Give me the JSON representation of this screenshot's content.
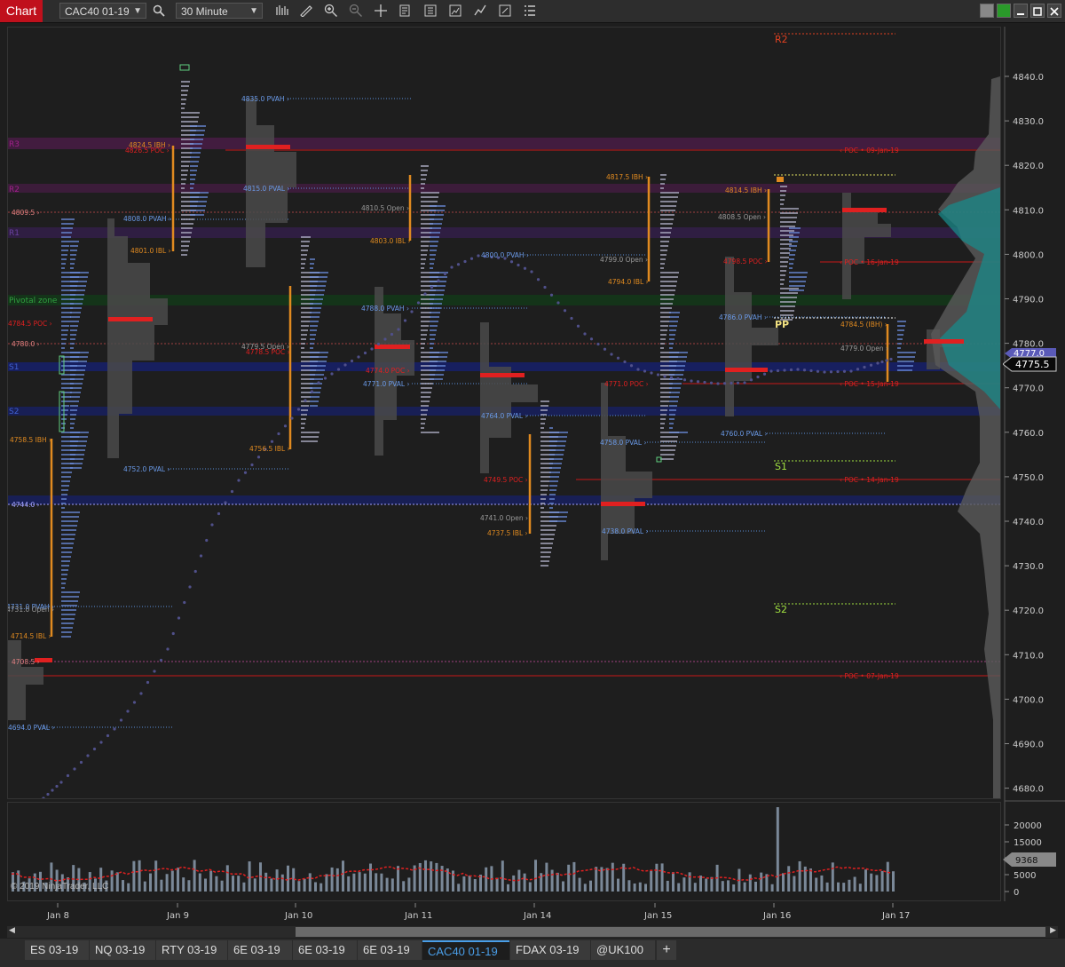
{
  "toolbar": {
    "chart_label": "Chart",
    "instrument": "CAC40 01-19",
    "interval": "30 Minute",
    "icons": [
      "search-icon",
      "bar-type-icon",
      "draw-icon",
      "zoom-in-icon",
      "zoom-out-icon",
      "crosshair-icon",
      "data-box-icon",
      "properties-icon",
      "strategies-icon",
      "drawing-tools-icon",
      "screenshot-icon",
      "list-icon"
    ]
  },
  "colors": {
    "accent": "#c0101c",
    "poc": "#e02020",
    "ib": "#e08a20",
    "va": "#5a8ed8",
    "vwap": "#4a4a9a",
    "pivot_r": "#a0208a",
    "pivot_s": "#2040a0"
  },
  "price_axis": {
    "ticks": [
      "4840.0",
      "4830.0",
      "4820.0",
      "4810.0",
      "4800.0",
      "4790.0",
      "4780.0",
      "4770.0",
      "4760.0",
      "4750.0",
      "4740.0",
      "4730.0",
      "4720.0",
      "4710.0",
      "4700.0",
      "4690.0",
      "4680.0"
    ],
    "last_price": "4775.5",
    "upper_marker": "4777.0"
  },
  "volume_axis": {
    "ticks": [
      "20000",
      "15000",
      "10000",
      "5000",
      "0"
    ],
    "last_volume": "9368"
  },
  "time_axis": {
    "labels": [
      "Jan 8",
      "Jan 9",
      "Jan 10",
      "Jan 11",
      "Jan 14",
      "Jan 15",
      "Jan 16",
      "Jan 17"
    ]
  },
  "pivots": {
    "r2": "R2",
    "r1": "R1",
    "pp": "PP",
    "s1": "S1",
    "s2": "S2",
    "left_r3": "R3",
    "left_r2": "R2",
    "left_r1": "R1",
    "left_s1": "S1",
    "left_s2": "S2",
    "pivotal_zone": "Pivotal zone"
  },
  "labels": {
    "pvah_4835": "4835.0 PVAH ›",
    "ibh_48245": "4824.5 IBH ›",
    "poc_48245": "4826.5 POC ›",
    "pval_4815": "4815.0 PVAL ›",
    "val_48095": "4809.5 ›",
    "pvah_4808": "4808.0 PVAH ›",
    "ibl_4801": "4801.0 IBL ›",
    "open_48105": "4810.5 Open ›",
    "ibl_4803": "4803.0 IBL ›",
    "pvah_4800": "4800.0 PVAH ›",
    "pvah_4788": "4788.0 PVAH ›",
    "poc_48045": "4784.5 POC ›",
    "v4780": "4780.0 ›",
    "open_47795": "4779.5 Open ›",
    "poc_47785": "4778.5 POC ›",
    "poc_4774": "4774.0 POC ›",
    "pval_4771": "4771.0 PVAL ›",
    "pval_4764": "4764.0 PVAL ›",
    "ibh_47585": "4758.5 IBH ›",
    "ibl_47565": "4756.5 IBL ›",
    "pval_4752": "4752.0 PVAL ›",
    "poc_47495": "4749.5 POC ›",
    "v4744": "4744.0 ›",
    "open_4741": "4741.0 Open ›",
    "ibl_47375": "4737.5 IBL ›",
    "pvah_4731": "4731.0 PVAH ›",
    "open_4731": "4731.0 Open ›",
    "ibl_47145": "4714.5 IBL ›",
    "v47085": "4708.5 ›",
    "pval_4694": "4694.0 PVAL ›",
    "ibh_48175": "4817.5 IBH ›",
    "open_4799": "4799.0 Open ›",
    "ibl_4794": "4794.0 IBL ›",
    "poc_4771": "4771.0 POC ›",
    "pval_4758": "4758.0 PVAL ›",
    "pval_4738": "4738.0 PVAL ›",
    "pvah_4786": "4786.0 PVAH ›",
    "pval_4760": "4760.0 PVAL ›",
    "ibh_48145": "4814.5 IBH ›",
    "open_48085": "4808.5 Open ›",
    "poc_47985": "4798.5 POC ›",
    "ibh_47845": "4784.5 (IBH) ›",
    "open_4779": "4779.0 Open ›",
    "npoc_0901": "‹ POC • 09-Jan-19",
    "npoc_1601": "‹ POC • 16-Jan-19",
    "npoc_1501": "‹ POC • 15-Jan-19",
    "npoc_1401": "‹ POC • 14-Jan-19",
    "npoc_0701": "‹ POC • 07-Jan-19"
  },
  "copyright": "© 2019 NinjaTrader, LLC",
  "bottom_tabs": [
    "ES 03-19",
    "NQ 03-19",
    "RTY 03-19",
    "6E 03-19",
    "6E 03-19",
    "6E 03-19",
    "CAC40 01-19",
    "FDAX 03-19",
    "@UK100"
  ],
  "active_tab": "CAC40 01-19",
  "add_tab_label": "+"
}
